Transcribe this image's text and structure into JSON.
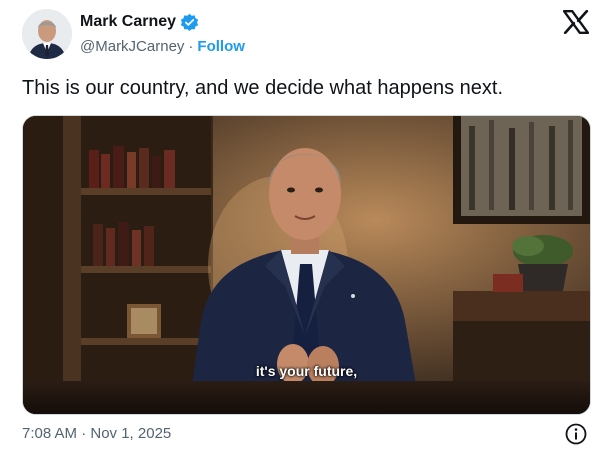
{
  "author": {
    "name": "Mark Carney",
    "handle": "@MarkJCarney",
    "separator": "·",
    "follow_label": "Follow",
    "verified_icon": "verified-badge-icon"
  },
  "tweet": {
    "text": "This is our country, and we decide what happens next.",
    "timestamp": "7:08 AM · Nov 1, 2025"
  },
  "media": {
    "caption": "it's your future,"
  },
  "icons": {
    "brand": "x-logo-icon",
    "info": "info-icon"
  },
  "colors": {
    "accent": "#1d9bf0",
    "text": "#0f1419",
    "secondary": "#536471"
  }
}
